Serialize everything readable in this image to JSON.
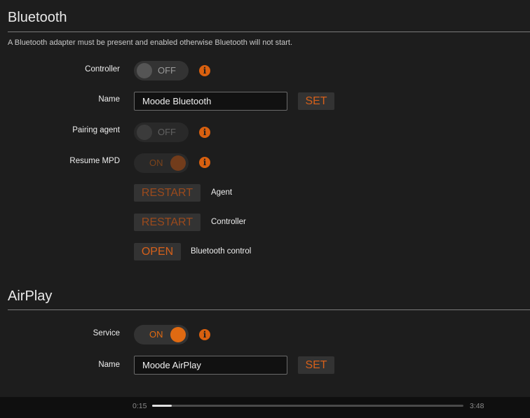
{
  "bluetooth": {
    "title": "Bluetooth",
    "description": "A Bluetooth adapter must be present and enabled otherwise Bluetooth will not start.",
    "controller": {
      "label": "Controller",
      "state": "OFF"
    },
    "name": {
      "label": "Name",
      "value": "Moode Bluetooth",
      "set_label": "SET"
    },
    "pairing_agent": {
      "label": "Pairing agent",
      "state": "OFF"
    },
    "resume_mpd": {
      "label": "Resume MPD",
      "state": "ON"
    },
    "restart_agent": {
      "button": "RESTART",
      "caption": "Agent"
    },
    "restart_controller": {
      "button": "RESTART",
      "caption": "Controller"
    },
    "open_control": {
      "button": "OPEN",
      "caption": "Bluetooth control"
    }
  },
  "airplay": {
    "title": "AirPlay",
    "service": {
      "label": "Service",
      "state": "ON"
    },
    "name": {
      "label": "Name",
      "value": "Moode AirPlay",
      "set_label": "SET"
    }
  },
  "info_icon": "i",
  "player": {
    "elapsed": "0:15",
    "duration": "3:48",
    "progress_fraction": 0.063
  },
  "colors": {
    "accent": "#d9600f",
    "background": "#1d1d1d"
  }
}
